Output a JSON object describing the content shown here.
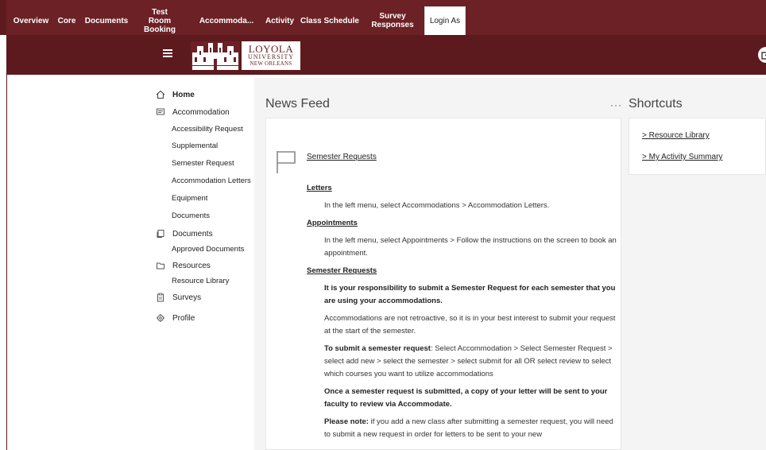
{
  "tabs": [
    {
      "label": "Overview",
      "active": false
    },
    {
      "label": "Core",
      "active": false
    },
    {
      "label": "Documents",
      "active": false
    },
    {
      "label": "Test Room Booking",
      "active": false
    },
    {
      "label": "Accommoda...",
      "active": false
    },
    {
      "label": "Activity",
      "active": false
    },
    {
      "label": "Class Schedule",
      "active": false
    },
    {
      "label": "Survey Responses",
      "active": false
    },
    {
      "label": "Login As",
      "active": true
    }
  ],
  "header": {
    "logo_line1": "LOYOLA",
    "logo_line2": "UNIVERSITY",
    "logo_line3": "NEW ORLEANS",
    "hamburger_icon": "menu-icon",
    "external_icon": "external-link-icon",
    "brand_color": "#6b2125"
  },
  "sidebar": {
    "home": "Home",
    "accommodation": "Accommodation",
    "accommodation_items": [
      "Accessibility Request",
      "Supplemental",
      "Semester Request",
      "Accommodation Letters",
      "Equipment",
      "Documents"
    ],
    "documents": "Documents",
    "documents_items": [
      "Approved Documents"
    ],
    "resources": "Resources",
    "resources_items": [
      "Resource Library"
    ],
    "surveys": "Surveys",
    "profile": "Profile"
  },
  "feed": {
    "title": "News Feed",
    "more": "···",
    "post_title": "Semester Requests",
    "letters_heading": "Letters",
    "letters_text": "In the left menu, select Accommodations > Accommodation Letters.",
    "appointments_heading": "Appointments",
    "appointments_text": "In the left menu, select Appointments > Follow the instructions on the screen to book an appointment.",
    "semester_heading": "Semester Requests",
    "semester_bold": "It is your responsibility to submit a Semester Request for each semester that you are using your accommodations.",
    "semester_text": "Accommodations are not retroactive, so it is in your best interest to submit your request at the start of the semester.",
    "submit_bold": "To submit a semester request",
    "submit_text": ":  Select Accommodation > Select Semester Request > select add new > select the semester > select submit for all OR select review to select which courses you want to utilize accommodations",
    "once_bold": "Once a semester request is submitted, a copy of your letter will be sent to your faculty to review via Accommodate.",
    "note_bold": "Please note:",
    "note_text": " if you add a new class after submitting a semester request, you will need to submit a new request in order for letters to be sent to your new"
  },
  "shortcuts": {
    "title": "Shortcuts",
    "links": [
      "> Resource Library",
      "> My Activity Summary"
    ]
  }
}
